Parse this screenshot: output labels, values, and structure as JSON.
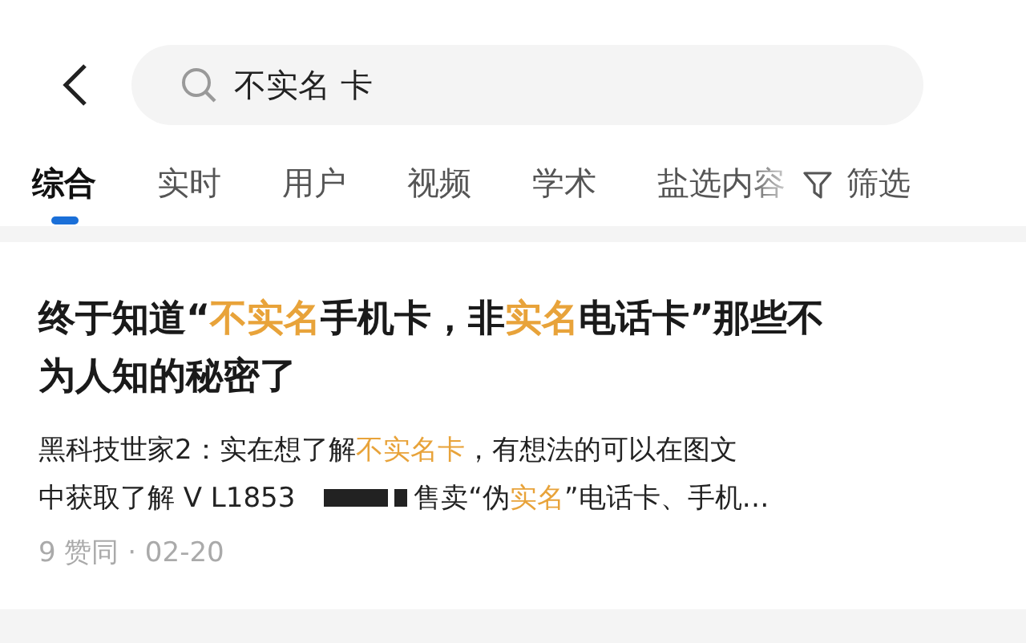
{
  "search": {
    "value": "不实名 卡"
  },
  "tabs": [
    {
      "label": "综合",
      "selected": true
    },
    {
      "label": "实时",
      "selected": false
    },
    {
      "label": "用户",
      "selected": false
    },
    {
      "label": "视频",
      "selected": false
    },
    {
      "label": "学术",
      "selected": false
    },
    {
      "label": "盐选内容",
      "selected": false
    }
  ],
  "filter": {
    "label": "筛选"
  },
  "result": {
    "title_lines": [
      [
        {
          "kind": "text",
          "text": "终于知道“"
        },
        {
          "kind": "highlight",
          "text": "不实名"
        },
        {
          "kind": "text",
          "text": "手机卡，非"
        },
        {
          "kind": "highlight",
          "text": "实名"
        },
        {
          "kind": "text",
          "text": "电话卡”那些不"
        }
      ],
      [
        {
          "kind": "text",
          "text": "为人知的秘密了"
        }
      ]
    ],
    "snippet_lines": [
      [
        {
          "kind": "text",
          "text": "黑科技世家2：实在想了解"
        },
        {
          "kind": "highlight",
          "text": "不实名卡"
        },
        {
          "kind": "text",
          "text": "，有想法的可以在图文"
        }
      ],
      [
        {
          "kind": "text",
          "text": "中获取了解 V L1853"
        },
        {
          "kind": "redaction"
        },
        {
          "kind": "text",
          "text": "售卖“伪"
        },
        {
          "kind": "highlight",
          "text": "实名"
        },
        {
          "kind": "text",
          "text": "”电话卡、手机…"
        }
      ]
    ],
    "meta": "9 赞同 · 02-20"
  }
}
